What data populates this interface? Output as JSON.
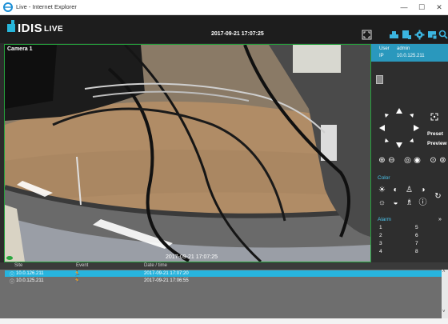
{
  "window": {
    "title": "Live - Internet Explorer",
    "minimize": "—",
    "maximize": "☐",
    "close": "✕"
  },
  "header": {
    "brand": "IDIS",
    "mode": "LIVE",
    "datetime": "2017-09-21 17:07:25",
    "icons": [
      "fullscreen-icon",
      "user-icon",
      "camera-setup-icon",
      "settings-icon",
      "layout-icon",
      "search-icon"
    ]
  },
  "video": {
    "camera_label": "Camera 1",
    "overlay_time": "2017-09-21 17:07:25",
    "border_color": "#25a03c"
  },
  "panel": {
    "user_key": "User",
    "user_value": "admin",
    "ip_key": "IP",
    "ip_value": "10.0.125.211",
    "preset_label": "Preset",
    "preview_label": "Preview",
    "color_label": "Color",
    "alarm_label": "Alarm",
    "alarms_left": [
      "1",
      "2",
      "3",
      "4"
    ],
    "alarms_right": [
      "5",
      "6",
      "7",
      "8"
    ],
    "accent": "#2a98bd"
  },
  "events": {
    "columns": [
      "Site",
      "Event",
      "Date / time"
    ],
    "rows": [
      {
        "site": "10.0.126.211",
        "datetime": "2017-09-21 17:07:20",
        "selected": true
      },
      {
        "site": "10.0.125.211",
        "datetime": "2017-09-21 17:06:55",
        "selected": false
      }
    ]
  }
}
